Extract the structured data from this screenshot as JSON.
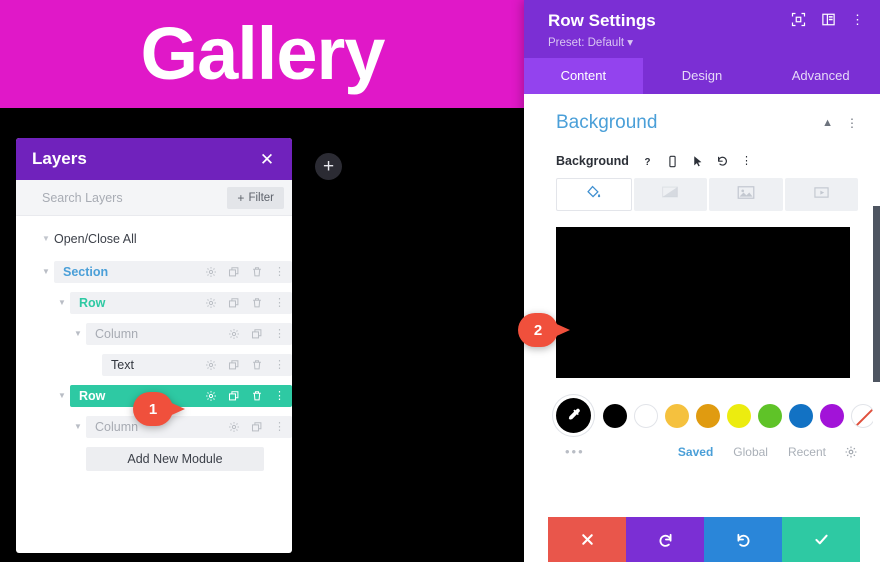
{
  "canvas": {
    "banner_text": "Gallery",
    "banner_color": "#e018c8",
    "add_button_label": "+"
  },
  "layers_panel": {
    "title": "Layers",
    "close_icon": "close-icon",
    "search_placeholder": "Search Layers",
    "search_value": "",
    "filter_label": "Filter",
    "open_close_all": "Open/Close All",
    "add_new_module": "Add New Module",
    "rows": [
      {
        "label": "Section",
        "type": "section",
        "level": 0,
        "selected": false,
        "has_trash": true
      },
      {
        "label": "Row",
        "type": "row",
        "level": 1,
        "selected": false,
        "has_trash": true
      },
      {
        "label": "Column",
        "type": "column",
        "level": 2,
        "selected": false,
        "has_trash": false
      },
      {
        "label": "Text",
        "type": "text",
        "level": 3,
        "selected": false,
        "has_trash": true
      },
      {
        "label": "Row",
        "type": "row",
        "level": 1,
        "selected": true,
        "has_trash": true
      },
      {
        "label": "Column",
        "type": "column",
        "level": 2,
        "selected": false,
        "has_trash": false
      }
    ],
    "row_icons": [
      "gear-icon",
      "duplicate-icon",
      "trash-icon",
      "more-vertical-icon"
    ],
    "colors": {
      "header": "#7022bc",
      "selected_row": "#2ec9a3",
      "section_label": "#4a9fd8",
      "row_label": "#2ec9a3"
    }
  },
  "markers": [
    {
      "number": "1",
      "color": "#f0503c"
    },
    {
      "number": "2",
      "color": "#f0503c"
    }
  ],
  "settings_panel": {
    "title": "Row Settings",
    "preset": "Preset: Default",
    "header_icons": [
      "focus-icon",
      "layout-icon",
      "more-vertical-icon"
    ],
    "tabs": [
      {
        "label": "Content",
        "active": true
      },
      {
        "label": "Design",
        "active": false
      },
      {
        "label": "Advanced",
        "active": false
      }
    ],
    "section": {
      "title": "Background",
      "collapse_icon": "chevron-up-icon",
      "more_icon": "more-vertical-icon"
    },
    "field": {
      "label": "Background",
      "icons": [
        "help-icon",
        "mobile-icon",
        "cursor-icon",
        "reset-icon",
        "more-vertical-icon"
      ]
    },
    "bg_tabs": [
      {
        "icon": "paint-bucket-icon",
        "active": true
      },
      {
        "icon": "gradient-icon",
        "active": false
      },
      {
        "icon": "image-icon",
        "active": false
      },
      {
        "icon": "video-icon",
        "active": false
      }
    ],
    "preview_color": "#000000",
    "eyedropper_icon": "eyedropper-icon",
    "swatches": [
      {
        "color": "#000000",
        "name": "black"
      },
      {
        "color": "#ffffff",
        "name": "white"
      },
      {
        "color": "#f5c13e",
        "name": "amber"
      },
      {
        "color": "#e09b10",
        "name": "dark-orange"
      },
      {
        "color": "#ecec0f",
        "name": "yellow"
      },
      {
        "color": "#5fc328",
        "name": "green"
      },
      {
        "color": "#1272c4",
        "name": "blue"
      },
      {
        "color": "#a213d8",
        "name": "purple"
      },
      {
        "color": "none",
        "name": "no-color"
      }
    ],
    "palette_more": "•••",
    "palette_tabs": [
      {
        "label": "Saved",
        "active": true
      },
      {
        "label": "Global",
        "active": false
      },
      {
        "label": "Recent",
        "active": false
      }
    ],
    "palette_settings_icon": "gear-icon",
    "actions": [
      {
        "name": "cancel",
        "icon": "x-icon",
        "color": "#e9564b"
      },
      {
        "name": "undo",
        "icon": "undo-icon",
        "color": "#7b2fd4"
      },
      {
        "name": "redo",
        "icon": "redo-icon",
        "color": "#2a86d9"
      },
      {
        "name": "save",
        "icon": "check-icon",
        "color": "#2ec9a3"
      }
    ]
  }
}
